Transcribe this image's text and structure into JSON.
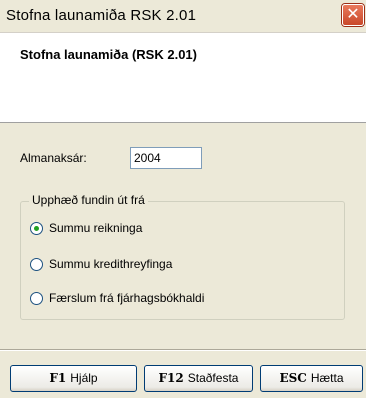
{
  "window": {
    "title": "Stofna launamiða RSK 2.01"
  },
  "header": {
    "title": "Stofna launamiða (RSK 2.01)"
  },
  "form": {
    "year_label": "Almanaksár:",
    "year_value": "2004",
    "group_label": "Upphæð fundin út frá",
    "options": [
      {
        "label": "Summu reikninga",
        "checked": true
      },
      {
        "label": "Summu kredithreyfinga",
        "checked": false
      },
      {
        "label": "Færslum frá fjárhagsbókhaldi",
        "checked": false
      }
    ]
  },
  "footer": {
    "buttons": [
      {
        "key": "F1",
        "label": "Hjálp"
      },
      {
        "key": "F12",
        "label": "Staðfesta"
      },
      {
        "key": "ESC",
        "label": "Hætta"
      }
    ]
  },
  "icons": {
    "close": "close-icon"
  }
}
